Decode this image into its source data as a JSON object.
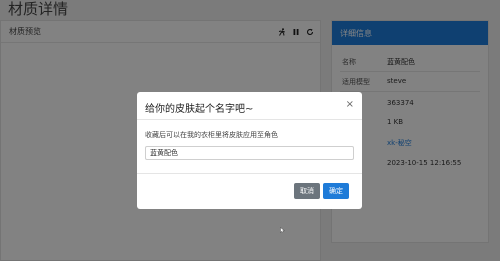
{
  "page": {
    "title": "材质详情"
  },
  "preview": {
    "title": "材质预览",
    "tools": {
      "run": "run-icon",
      "pause": "pause-icon",
      "refresh": "refresh-icon"
    }
  },
  "info": {
    "title": "详细信息",
    "rows": [
      {
        "label": "名称",
        "value": "蓝黄配色"
      },
      {
        "label": "适用模型",
        "value": "steve"
      },
      {
        "label": "",
        "value": "363374"
      },
      {
        "label": "大小",
        "value": "1 KB"
      },
      {
        "label": "者",
        "value": "xk-秘空"
      },
      {
        "label": "日期",
        "value": "2023-10-15 12:16:55"
      }
    ]
  },
  "modal": {
    "title": "给你的皮肤起个名字吧~",
    "close": "×",
    "description": "收藏后可以在我的衣柜里将皮肤应用至角色",
    "input_value": "蓝黄配色",
    "cancel_label": "取消",
    "confirm_label": "确定"
  },
  "colors": {
    "accent": "#1e7bd8",
    "cancel": "#6c757d"
  }
}
